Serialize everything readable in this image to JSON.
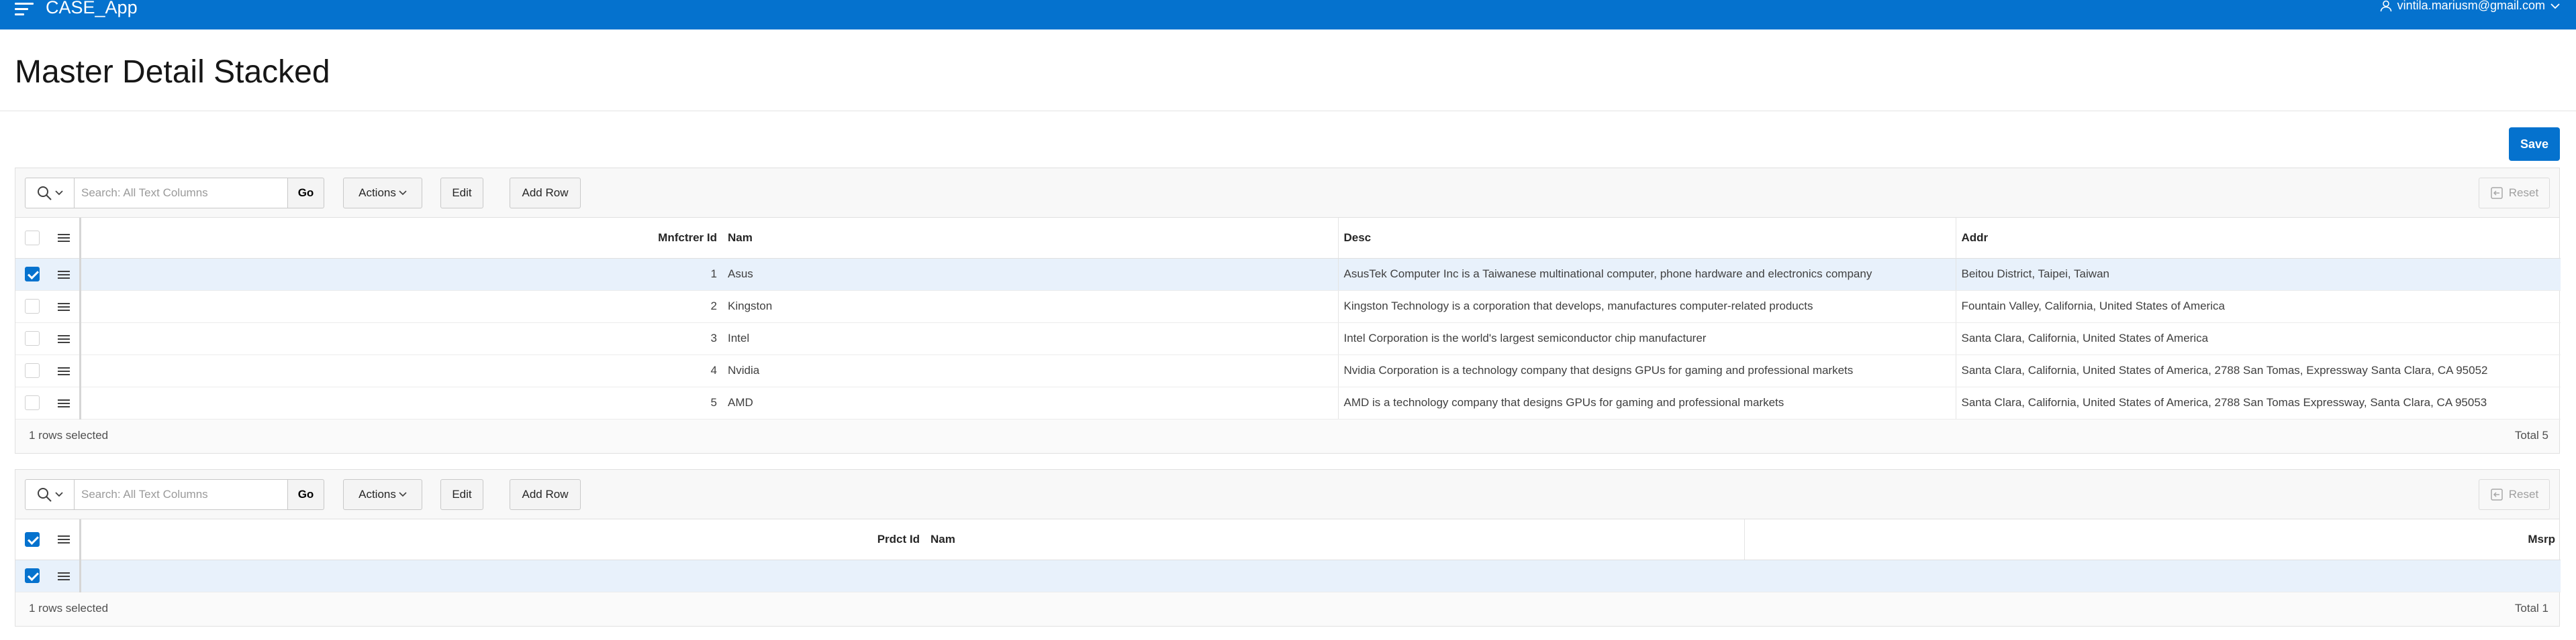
{
  "app": {
    "title": "CASE_App",
    "user": "vintila.mariusm@gmail.com"
  },
  "page": {
    "title": "Master Detail Stacked",
    "save_label": "Save"
  },
  "master": {
    "search_placeholder": "Search: All Text Columns",
    "go_label": "Go",
    "actions_label": "Actions",
    "edit_label": "Edit",
    "add_row_label": "Add Row",
    "reset_label": "Reset",
    "columns": [
      "Mnfctrer Id",
      "Nam",
      "Desc",
      "Addr"
    ],
    "rows": [
      {
        "id": "1",
        "nam": "Asus",
        "desc": "AsusTek Computer Inc is a Taiwanese multinational computer, phone hardware and electronics company",
        "addr": "Beitou District, Taipei, Taiwan",
        "selected": true
      },
      {
        "id": "2",
        "nam": "Kingston",
        "desc": "Kingston Technology is a corporation that develops, manufactures computer-related products",
        "addr": "Fountain Valley, California, United States of America",
        "selected": false
      },
      {
        "id": "3",
        "nam": "Intel",
        "desc": "Intel Corporation is the world's largest semiconductor chip manufacturer",
        "addr": "Santa Clara, California, United States of America",
        "selected": false
      },
      {
        "id": "4",
        "nam": "Nvidia",
        "desc": "Nvidia Corporation is a technology company that designs GPUs for gaming and professional markets",
        "addr": "Santa Clara, California, United States of America, 2788 San Tomas, Expressway Santa Clara, CA 95052",
        "selected": false
      },
      {
        "id": "5",
        "nam": "AMD",
        "desc": "AMD is a technology company that designs GPUs for gaming and professional markets",
        "addr": "Santa Clara, California, United States of America, 2788 San Tomas Expressway, Santa Clara, CA 95053",
        "selected": false
      }
    ],
    "selected_text": "1 rows selected",
    "total_text": "Total 5"
  },
  "detail": {
    "search_placeholder": "Search: All Text Columns",
    "go_label": "Go",
    "actions_label": "Actions",
    "edit_label": "Edit",
    "add_row_label": "Add Row",
    "reset_label": "Reset",
    "columns": [
      "Prdct Id",
      "Nam",
      "Msrp"
    ],
    "selected_text": "1 rows selected",
    "total_text": "Total 1"
  }
}
